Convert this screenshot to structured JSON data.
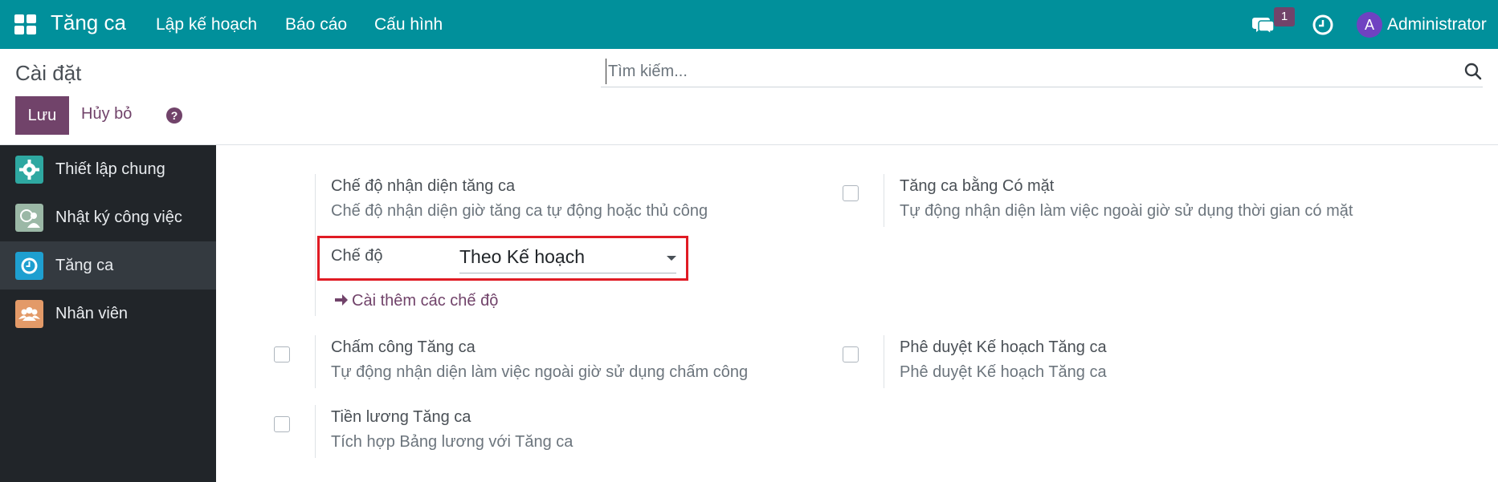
{
  "navbar": {
    "app_title": "Tăng ca",
    "menu": [
      "Lập kế hoạch",
      "Báo cáo",
      "Cấu hình"
    ],
    "message_badge": "1",
    "avatar_letter": "A",
    "user_name": "Administrator",
    "bg_color": "#01909b"
  },
  "control_panel": {
    "title": "Cài đặt",
    "search_placeholder": "Tìm kiếm...",
    "save_label": "Lưu",
    "cancel_label": "Hủy bỏ",
    "help_glyph": "?"
  },
  "sidebar": {
    "items": [
      {
        "label": "Thiết lập chung",
        "icon": "gear-icon",
        "active": false
      },
      {
        "label": "Nhật ký công việc",
        "icon": "timesheet-icon",
        "active": false
      },
      {
        "label": "Tăng ca",
        "icon": "overtime-clock-icon",
        "active": true
      },
      {
        "label": "Nhân viên",
        "icon": "employees-icon",
        "active": false
      }
    ]
  },
  "settings": {
    "recognition_mode": {
      "title": "Chế độ nhận diện tăng ca",
      "desc": "Chế độ nhận diện giờ tăng ca tự động hoặc thủ công",
      "mode_label": "Chế độ",
      "mode_value": "Theo Kế hoạch",
      "more_link": "Cài thêm các chế độ"
    },
    "attendance_overtime": {
      "title": "Tăng ca bằng Có mặt",
      "desc": "Tự động nhận diện làm việc ngoài giờ sử dụng thời gian có mặt",
      "checked": false
    },
    "timekeeping_overtime": {
      "title": "Chấm công Tăng ca",
      "desc": "Tự động nhận diện làm việc ngoài giờ sử dụng chấm công",
      "checked": false
    },
    "plan_approval": {
      "title": "Phê duyệt Kế hoạch Tăng ca",
      "desc": "Phê duyệt Kế hoạch Tăng ca",
      "checked": false
    },
    "overtime_payroll": {
      "title": "Tiền lương Tăng ca",
      "desc": "Tích hợp Bảng lương với Tăng ca",
      "checked": false
    }
  }
}
